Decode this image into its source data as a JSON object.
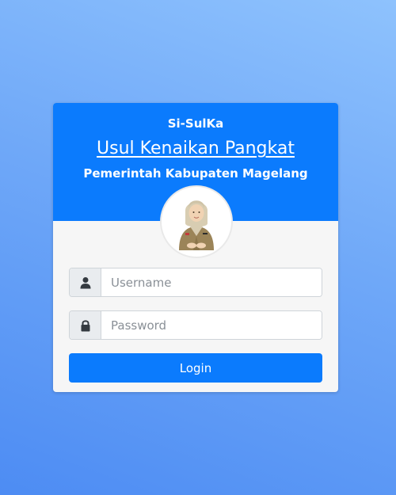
{
  "header": {
    "app_name": "Si-SulKa",
    "title": "Usul Kenaikan Pangkat",
    "subtitle": "Pemerintah Kabupaten Magelang"
  },
  "avatar": {
    "icon": "official-avatar-icon"
  },
  "form": {
    "username": {
      "icon": "user-icon",
      "placeholder": "Username",
      "value": ""
    },
    "password": {
      "icon": "lock-icon",
      "placeholder": "Password",
      "value": ""
    },
    "login_label": "Login"
  },
  "colors": {
    "primary": "#0b7bfd",
    "card_body": "#f6f6f6",
    "addon": "#e9ecef"
  }
}
